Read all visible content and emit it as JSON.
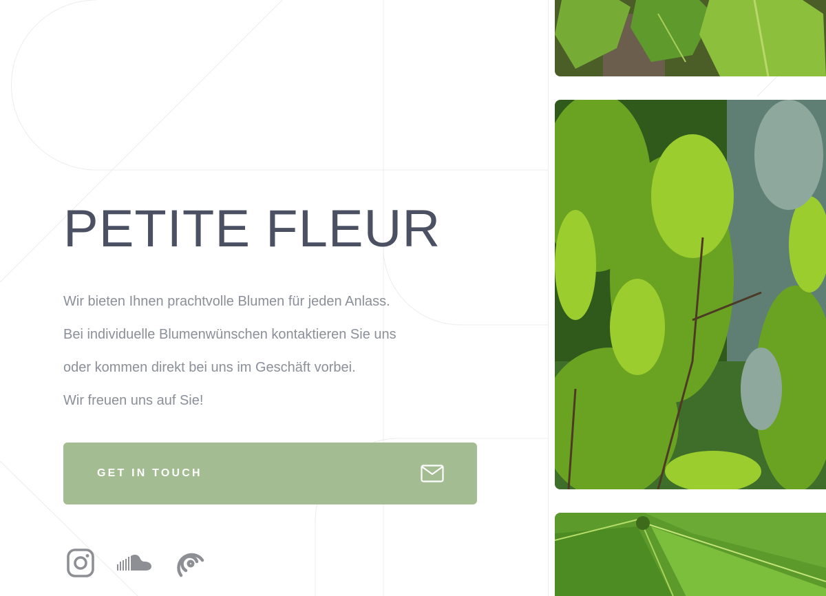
{
  "hero": {
    "title": "PETITE FLEUR",
    "intro_lines": [
      "Wir bieten Ihnen prachtvolle Blumen für jeden Anlass.",
      "Bei individuelle Blumenwünschen kontaktieren Sie uns",
      "oder kommen direkt bei uns im Geschäft vorbei.",
      "Wir freuen uns auf Sie!"
    ]
  },
  "cta": {
    "label": "GET IN TOUCH",
    "icon": "envelope-icon"
  },
  "social": [
    {
      "name": "instagram-icon"
    },
    {
      "name": "soundcloud-icon"
    },
    {
      "name": "podcast-icon"
    }
  ],
  "gallery": [
    {
      "subject": "maple leaves"
    },
    {
      "subject": "cypress conifer foliage"
    },
    {
      "subject": "green palm leaves"
    }
  ],
  "colors": {
    "title": "#4b5162",
    "text": "#8a8f99",
    "accent": "#a3bc91",
    "icon": "#8d8f94"
  }
}
